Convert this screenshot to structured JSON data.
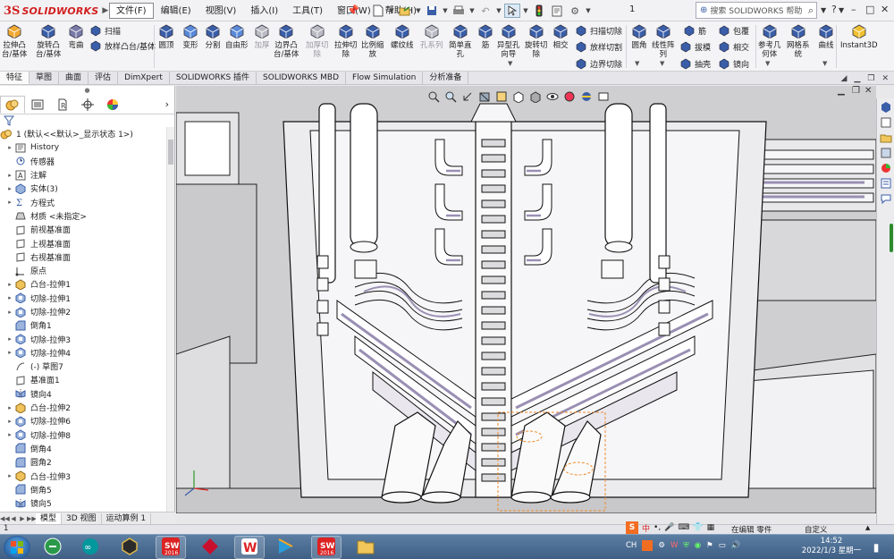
{
  "titlebar": {
    "brand": "SOLIDWORKS",
    "brand_mark": "3S",
    "menus": [
      "文件(F)",
      "编辑(E)",
      "视图(V)",
      "插入(I)",
      "工具(T)",
      "窗口(W)",
      "帮助(H)"
    ],
    "doc_title": "1",
    "help_search_placeholder": "搜索 SOLIDWORKS 帮助",
    "window_buttons": [
      "?",
      "–",
      "□",
      "✕"
    ]
  },
  "commands": {
    "big": [
      {
        "label": "拉伸凸\n台/基体",
        "icon": "extrude-boss-icon",
        "dim": false
      },
      {
        "label": "旋转凸\n台/基体",
        "icon": "revolve-boss-icon",
        "dim": false
      },
      {
        "label": "弯曲",
        "icon": "flex-icon",
        "dim": false
      },
      {
        "label": "圆顶",
        "icon": "dome-icon",
        "dim": false
      },
      {
        "label": "变形",
        "icon": "deform-icon",
        "dim": false
      },
      {
        "label": "分割",
        "icon": "split-icon",
        "dim": false
      },
      {
        "label": "自由形",
        "icon": "freeform-icon",
        "dim": false
      },
      {
        "label": "加厚",
        "icon": "thicken-icon",
        "dim": true
      },
      {
        "label": "边界凸\n台/基体",
        "icon": "boundary-boss-icon",
        "dim": false
      },
      {
        "label": "加厚切\n除",
        "icon": "thicken-cut-icon",
        "dim": true
      },
      {
        "label": "拉伸切\n除",
        "icon": "extrude-cut-icon",
        "dim": false
      },
      {
        "label": "比例缩\n放",
        "icon": "scale-icon",
        "dim": false
      },
      {
        "label": "螺纹线",
        "icon": "thread-icon",
        "dim": false
      },
      {
        "label": "孔系列",
        "icon": "hole-series-icon",
        "dim": true
      },
      {
        "label": "简单直\n孔",
        "icon": "simple-hole-icon",
        "dim": false
      },
      {
        "label": "筋",
        "icon": "rib-icon",
        "dim": false
      },
      {
        "label": "异型孔\n向导",
        "icon": "hole-wizard-icon",
        "dim": false
      },
      {
        "label": "旋转切\n除",
        "icon": "revolve-cut-icon",
        "dim": false
      },
      {
        "label": "相交",
        "icon": "intersect-icon",
        "dim": false
      },
      {
        "label": "圆角",
        "icon": "fillet-icon",
        "dim": false
      },
      {
        "label": "线性阵\n列",
        "icon": "linear-pattern-icon",
        "dim": false
      },
      {
        "label": "参考几\n何体",
        "icon": "reference-geometry-icon",
        "dim": false
      },
      {
        "label": "网格系\n统",
        "icon": "mesh-system-icon",
        "dim": false
      },
      {
        "label": "曲线",
        "icon": "curves-icon",
        "dim": false
      },
      {
        "label": "Instant3D",
        "icon": "instant3d-icon",
        "dim": false
      }
    ],
    "small": [
      {
        "label": "扫描",
        "icon": "sweep-icon"
      },
      {
        "label": "放样凸台/基体",
        "icon": "loft-boss-icon"
      },
      {
        "label": "扫描切除",
        "icon": "swept-cut-icon"
      },
      {
        "label": "放样切割",
        "icon": "lofted-cut-icon"
      },
      {
        "label": "边界切除",
        "icon": "boundary-cut-icon"
      },
      {
        "label": "筋",
        "icon": "rib-icon"
      },
      {
        "label": "拔模",
        "icon": "draft-icon"
      },
      {
        "label": "抽壳",
        "icon": "shell-icon"
      },
      {
        "label": "包覆",
        "icon": "wrap-icon"
      },
      {
        "label": "相交",
        "icon": "intersect-icon"
      },
      {
        "label": "镜向",
        "icon": "mirror-icon"
      }
    ]
  },
  "tabs": [
    "特征",
    "草图",
    "曲面",
    "评估",
    "DimXpert",
    "SOLIDWORKS 插件",
    "SOLIDWORKS MBD",
    "Flow Simulation",
    "分析准备"
  ],
  "tabs_active": 0,
  "tree": {
    "root": "1 (默认<<默认>_显示状态 1>)",
    "items": [
      {
        "label": "History",
        "icon": "history-icon",
        "exp": "▸"
      },
      {
        "label": "传感器",
        "icon": "sensor-icon",
        "exp": ""
      },
      {
        "label": "注解",
        "icon": "annotation-icon",
        "exp": "▸"
      },
      {
        "label": "实体(3)",
        "icon": "solid-bodies-icon",
        "exp": "▸"
      },
      {
        "label": "方程式",
        "icon": "equations-icon",
        "exp": "▸"
      },
      {
        "label": "材质 <未指定>",
        "icon": "material-icon",
        "exp": ""
      },
      {
        "label": "前视基准面",
        "icon": "plane-icon",
        "exp": ""
      },
      {
        "label": "上视基准面",
        "icon": "plane-icon",
        "exp": ""
      },
      {
        "label": "右视基准面",
        "icon": "plane-icon",
        "exp": ""
      },
      {
        "label": "原点",
        "icon": "origin-icon",
        "exp": ""
      },
      {
        "label": "凸台-拉伸1",
        "icon": "boss-extrude-icon",
        "exp": "▸"
      },
      {
        "label": "切除-拉伸1",
        "icon": "cut-extrude-icon",
        "exp": "▸"
      },
      {
        "label": "切除-拉伸2",
        "icon": "cut-extrude-icon",
        "exp": "▸"
      },
      {
        "label": "倒角1",
        "icon": "chamfer-icon",
        "exp": ""
      },
      {
        "label": "切除-拉伸3",
        "icon": "cut-extrude-icon",
        "exp": "▸"
      },
      {
        "label": "切除-拉伸4",
        "icon": "cut-extrude-icon",
        "exp": "▸"
      },
      {
        "label": "(-) 草图7",
        "icon": "sketch-icon",
        "exp": ""
      },
      {
        "label": "基准面1",
        "icon": "plane-icon",
        "exp": ""
      },
      {
        "label": "镜向4",
        "icon": "mirror-feature-icon",
        "exp": ""
      },
      {
        "label": "凸台-拉伸2",
        "icon": "boss-extrude-icon",
        "exp": "▸"
      },
      {
        "label": "切除-拉伸6",
        "icon": "cut-extrude-icon",
        "exp": "▸"
      },
      {
        "label": "切除-拉伸8",
        "icon": "cut-extrude-icon",
        "exp": "▸"
      },
      {
        "label": "倒角4",
        "icon": "chamfer-icon",
        "exp": ""
      },
      {
        "label": "圆角2",
        "icon": "fillet-icon",
        "exp": ""
      },
      {
        "label": "凸台-拉伸3",
        "icon": "boss-extrude-icon",
        "exp": "▸"
      },
      {
        "label": "倒角5",
        "icon": "chamfer-icon",
        "exp": ""
      },
      {
        "label": "镜向5",
        "icon": "mirror-feature-icon",
        "exp": ""
      }
    ]
  },
  "bottom_tabs": [
    "模型",
    "3D 视图",
    "运动算例 1"
  ],
  "status": {
    "left": "1",
    "editing": "在编辑 零件",
    "custom": "自定义"
  },
  "taskbar": {
    "apps": [
      {
        "name": "ie-icon",
        "open": false
      },
      {
        "name": "arduino-icon",
        "open": false
      },
      {
        "name": "gold-app-icon",
        "open": false
      },
      {
        "name": "solidworks-2016-icon",
        "open": true
      },
      {
        "name": "red-app-icon",
        "open": false
      },
      {
        "name": "wps-icon",
        "open": true
      },
      {
        "name": "media-player-icon",
        "open": false
      },
      {
        "name": "solidworks-2016-icon-2",
        "open": true
      },
      {
        "name": "folder-icon",
        "open": false
      }
    ],
    "sw_label": "SW",
    "sw_year": "2016",
    "tray_text": "CH",
    "time": "14:52",
    "date": "2022/1/3 星期一"
  },
  "colors": {
    "accent": "#d21f1f",
    "brand_blue": "#3a5ea8",
    "model_fill": "#f4f4f6",
    "model_purple": "#9a8fb3",
    "selection_orange": "#f08a2c"
  }
}
